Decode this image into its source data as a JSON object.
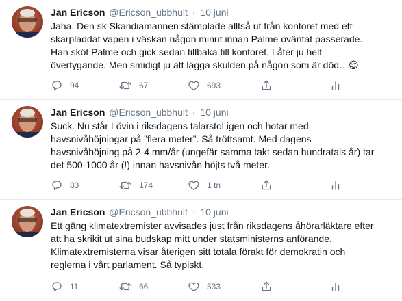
{
  "tweets": [
    {
      "name": "Jan Ericson",
      "handle": "@Ericson_ubbhult",
      "separator": "·",
      "date": "10 juni",
      "lines": [
        "Jaha. Den sk Skandiamannen stämplade alltså ut från kontoret med ett",
        "skarpladdat vapen i väskan någon minut innan Palme oväntat passerade.",
        "Han sköt Palme och gick sedan tillbaka till kontoret. Låter ju helt",
        "övertygande. Men smidigt ju att lägga skulden på någon som är död…😌"
      ],
      "replies": "94",
      "retweets": "67",
      "likes": "693"
    },
    {
      "name": "Jan Ericson",
      "handle": "@Ericson_ubbhult",
      "separator": "·",
      "date": "10 juni",
      "lines": [
        "Suck. Nu står Lövin i riksdagens talarstol igen och hotar med",
        "havsnivåhöjningar på ”flera meter”. Så tröttsamt. Med dagens",
        "havsnivåhöjning på 2-4 mm/år (ungefär samma takt sedan hundratals år) tar",
        "det 500-1000 år (!) innan havsnivån höjts två meter."
      ],
      "replies": "83",
      "retweets": "174",
      "likes": "1 tn"
    },
    {
      "name": "Jan Ericson",
      "handle": "@Ericson_ubbhult",
      "separator": "·",
      "date": "10 juni",
      "lines": [
        "Ett gäng klimatextremister avvisades just från riksdagens åhörarläktare efter",
        "att ha skrikit ut sina budskap mitt under statsministerns anförande.",
        "Klimatextremisterna visar återigen sitt totala förakt för demokratin och",
        "reglerna i vårt parlament. Så typiskt."
      ],
      "replies": "11",
      "retweets": "66",
      "likes": "533"
    }
  ],
  "icons": {
    "reply": "reply-icon",
    "retweet": "retweet-icon",
    "like": "heart-icon",
    "dm": "share-icon",
    "stats": "analytics-icon",
    "caret": "chevron-down-icon"
  },
  "colors": {
    "text": "#14171a",
    "muted": "#657786",
    "border": "#e6ecf0"
  }
}
